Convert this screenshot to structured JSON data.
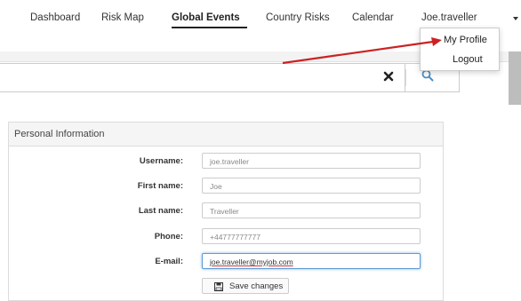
{
  "nav": {
    "items": [
      "Dashboard",
      "Risk Map",
      "Global Events",
      "Country Risks",
      "Calendar"
    ],
    "active": "Global Events",
    "user": "Joe.traveller"
  },
  "user_menu": {
    "items": [
      "My Profile",
      "Logout"
    ]
  },
  "search": {
    "value": ""
  },
  "personal_info": {
    "title": "Personal Information",
    "fields": [
      {
        "label": "Username:",
        "value": "joe.traveller"
      },
      {
        "label": "First name:",
        "value": "Joe"
      },
      {
        "label": "Last name:",
        "value": "Traveller"
      },
      {
        "label": "Phone:",
        "value": "+44777777777"
      },
      {
        "label": "E-mail:",
        "value": "joe.traveller@myjob.com"
      }
    ],
    "save_label": "Save changes"
  },
  "icons": {
    "clear": "close-icon",
    "search": "search-icon",
    "save": "floppy-disk-icon",
    "user_caret": "caret-down-icon"
  },
  "colors": {
    "annotation_arrow": "#cc2222",
    "focus_border": "#5b9bd5",
    "search_icon": "#4a90c8"
  }
}
